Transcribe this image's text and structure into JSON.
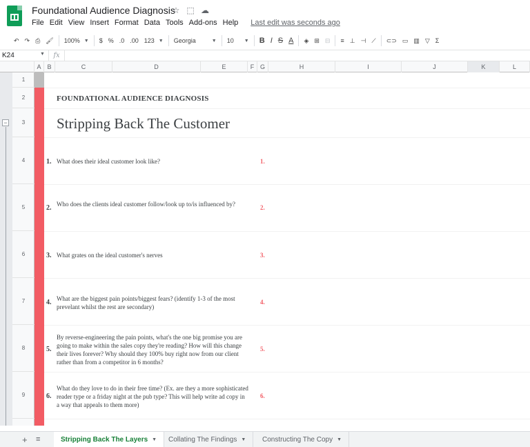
{
  "app": {
    "title": "Foundational Audience Diagnosis",
    "menus": [
      "File",
      "Edit",
      "View",
      "Insert",
      "Format",
      "Data",
      "Tools",
      "Add-ons",
      "Help"
    ],
    "last_edit": "Last edit was seconds ago",
    "title_icons": [
      "star-icon",
      "folder-icon",
      "cloud-icon"
    ]
  },
  "toolbar": {
    "zoom": "100%",
    "currency": "$",
    "percent": "%",
    "dec_less": ".0",
    "dec_more": ".00",
    "more_formats": "123",
    "font": "Georgia",
    "font_size": "10",
    "bold": "B",
    "italic": "I",
    "strike": "S",
    "text_color": "A"
  },
  "formula_bar": {
    "cell_ref": "K24",
    "fx": "fx"
  },
  "columns": [
    "A",
    "B",
    "C",
    "D",
    "E",
    "F",
    "G",
    "H",
    "I",
    "J",
    "K",
    "L"
  ],
  "rows": [
    "1",
    "2",
    "3",
    "4",
    "5",
    "6",
    "7",
    "8",
    "9"
  ],
  "sheet": {
    "subtitle": "FOUNDATIONAL AUDIENCE DIAGNOSIS",
    "heading": "Stripping Back The Customer",
    "questions": [
      {
        "num": "1.",
        "text": "What does their ideal customer look like?",
        "answer_num": "1."
      },
      {
        "num": "2.",
        "text": "Who does the clients ideal customer follow/look up to/is influenced by?",
        "answer_num": "2."
      },
      {
        "num": "3.",
        "text": "What grates on the ideal customer's nerves",
        "answer_num": "3."
      },
      {
        "num": "4.",
        "text": "What are the biggest pain points/biggest fears? (identify 1-3 of the most prevelant whilst the rest are secondary)",
        "answer_num": "4."
      },
      {
        "num": "5.",
        "text": "By reverse-engineering the pain points, what's the one big promise you are going to make within the sales copy they're reading? How will this change their lives forever? Why should they 100% buy right now from our client rather than from a competitor in 6 months?",
        "answer_num": "5."
      },
      {
        "num": "6.",
        "text": "What do they love to do in their free time? (Ex. are they a more sophisticated reader type or a friday night at the pub type? This will help write ad copy in a way that appeals to them more)",
        "answer_num": "6."
      }
    ]
  },
  "tabs": [
    {
      "label": "Stripping Back The Layers",
      "active": true
    },
    {
      "label": "Collating The Findings",
      "active": false
    },
    {
      "label": "Constructing The Copy",
      "active": false
    }
  ],
  "colors": {
    "accent_red": "#f25c64",
    "sheets_green": "#0f9d58",
    "active_tab_green": "#188038"
  }
}
